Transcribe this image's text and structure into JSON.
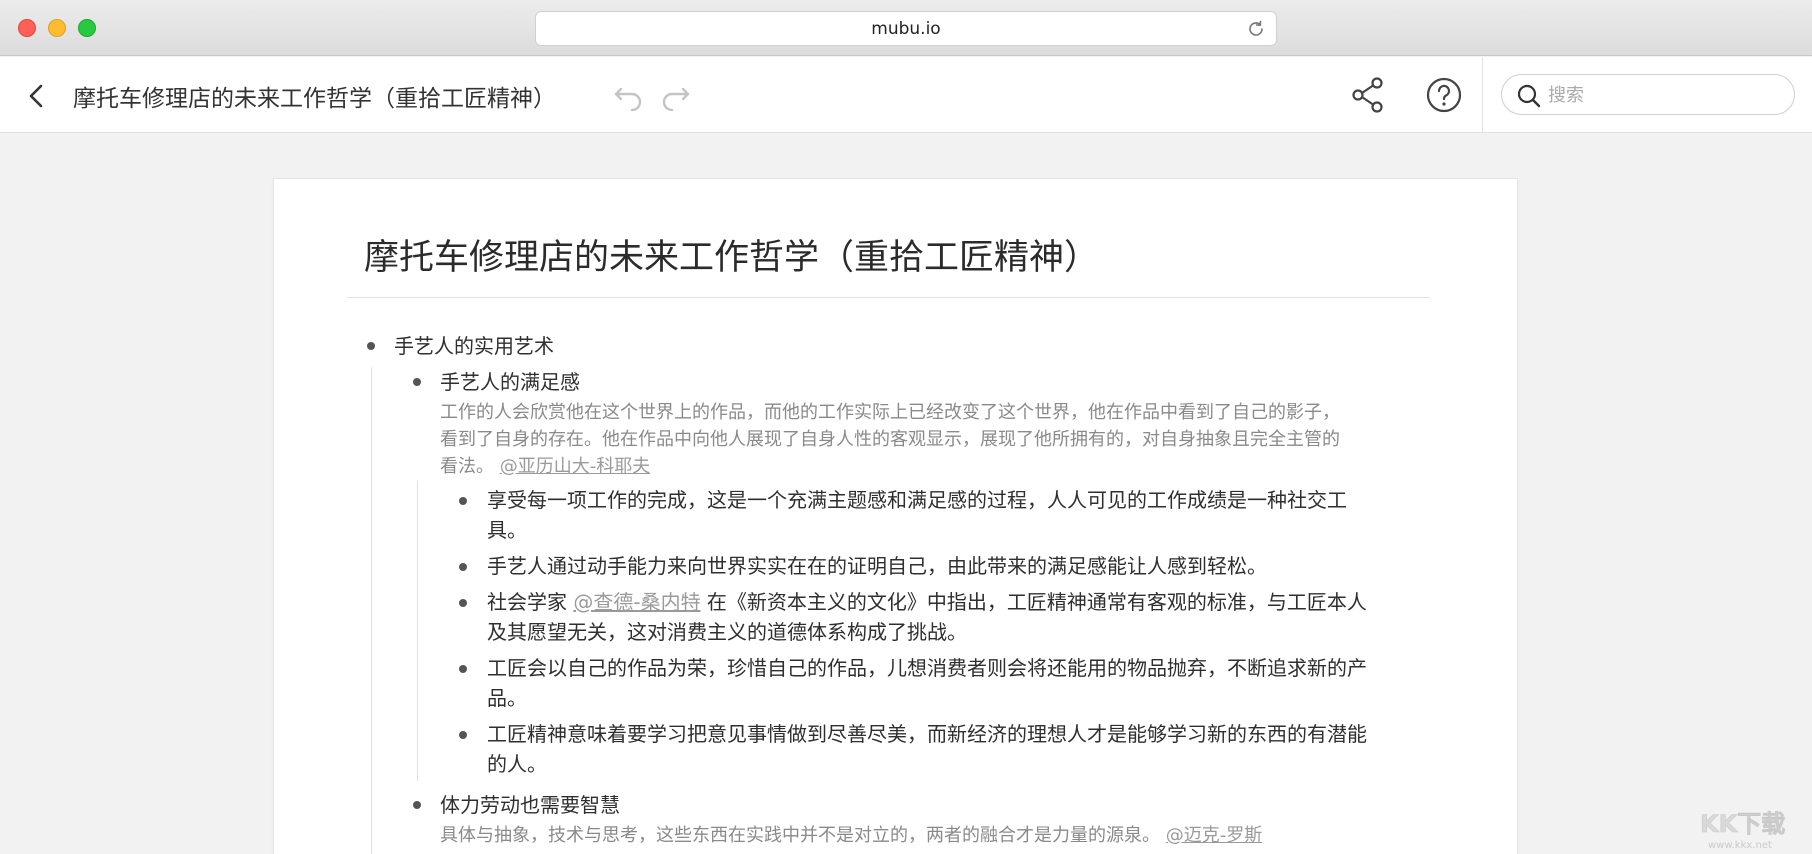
{
  "browser": {
    "url": "mubu.io"
  },
  "header": {
    "doc_title": "摩托车修理店的未来工作哲学（重拾工匠精神）",
    "search_placeholder": "搜索"
  },
  "document": {
    "title": "摩托车修理店的未来工作哲学（重拾工匠精神）",
    "node1": {
      "text": "手艺人的实用艺术"
    },
    "node1_1": {
      "text": "手艺人的满足感",
      "note_line1": "工作的人会欣赏他在这个世界上的作品，而他的工作实际上已经改变了这个世界，他在作品中看到了自己的影子，",
      "note_line2": "看到了自身的存在。他在作品中向他人展现了自身人性的客观显示，展现了他所拥有的，对自身抽象且完全主管的",
      "note_line3_prefix": "看法。",
      "note_mention": "@亚历山大-科耶夫"
    },
    "leaf1": {
      "line1": "享受每一项工作的完成，这是一个充满主题感和满足感的过程，人人可见的工作成绩是一种社交工",
      "line2": "具。"
    },
    "leaf2": {
      "line1": "手艺人通过动手能力来向世界实实在在的证明自己，由此带来的满足感能让人感到轻松。"
    },
    "leaf3": {
      "prefix": "社会学家 ",
      "mention": "@查德-桑内特",
      "suffix": " 在《新资本主义的文化》中指出，工匠精神通常有客观的标准，与工匠本人",
      "line2": "及其愿望无关，这对消费主义的道德体系构成了挑战。"
    },
    "leaf4": {
      "line1": "工匠会以自己的作品为荣，珍惜自己的作品，儿想消费者则会将还能用的物品抛弃，不断追求新的产",
      "line2": "品。"
    },
    "leaf5": {
      "line1": "工匠精神意味着要学习把意见事情做到尽善尽美，而新经济的理想人才是能够学习新的东西的有潜能",
      "line2": "的人。"
    },
    "node1_2": {
      "text": "体力劳动也需要智慧",
      "note_prefix": "具体与抽象，技术与思考，这些东西在实践中并不是对立的，两者的融合才是力量的源泉。",
      "note_mention": "@迈克-罗斯"
    }
  },
  "watermark": {
    "text": "KK下载",
    "url": "www.kkx.net"
  }
}
